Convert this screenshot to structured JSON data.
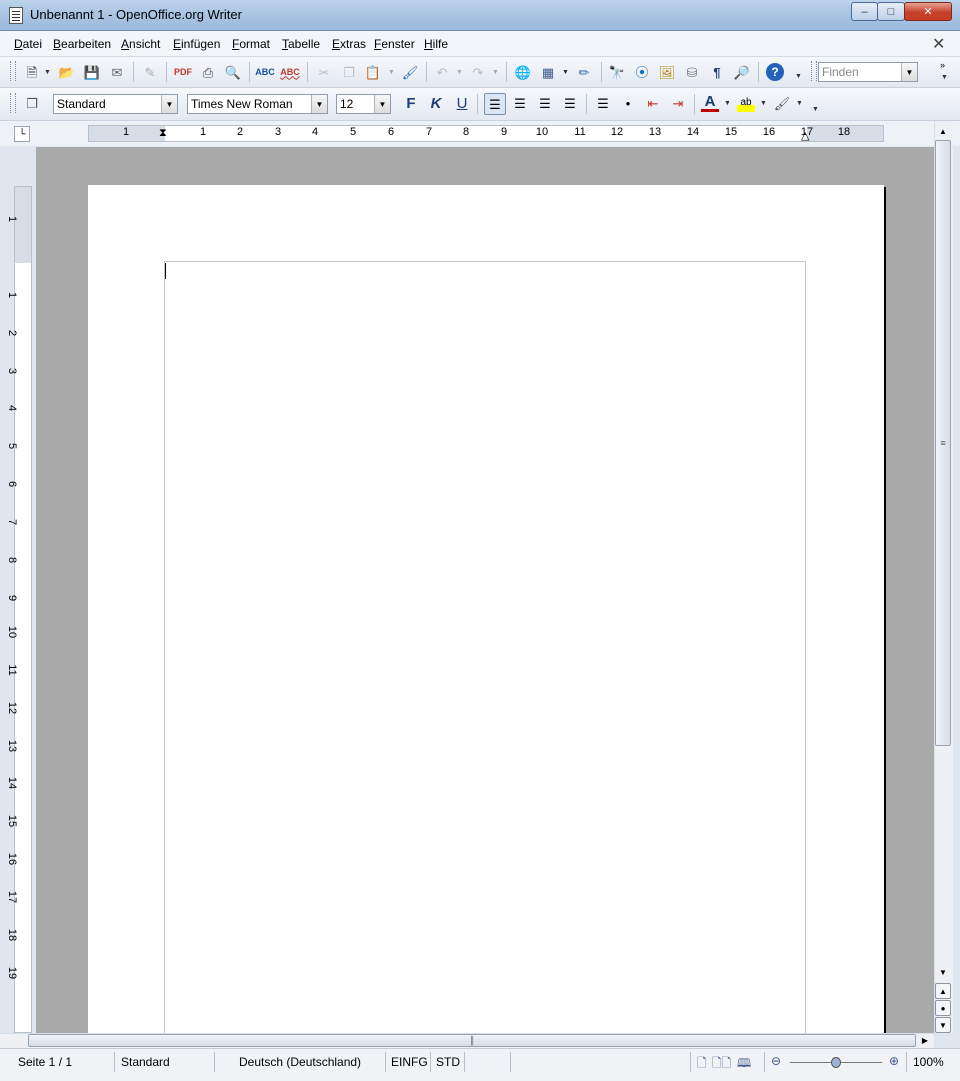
{
  "window": {
    "title": "Unbenannt 1 - OpenOffice.org Writer"
  },
  "menu": [
    "Datei",
    "Bearbeiten",
    "Ansicht",
    "Einfügen",
    "Format",
    "Tabelle",
    "Extras",
    "Fenster",
    "Hilfe"
  ],
  "toolbar": {
    "find_placeholder": "Finden",
    "style": "Standard",
    "font": "Times New Roman",
    "size": "12",
    "bold": "F",
    "italic": "K",
    "underline": "U"
  },
  "ruler": {
    "horizontal": [
      "1",
      "1",
      "2",
      "3",
      "4",
      "5",
      "6",
      "7",
      "8",
      "9",
      "10",
      "11",
      "12",
      "13",
      "14",
      "15",
      "16",
      "17",
      "18"
    ],
    "vertical": [
      "1",
      "1",
      "2",
      "3",
      "4",
      "5",
      "6",
      "7",
      "8",
      "9",
      "10",
      "11",
      "12",
      "13",
      "14",
      "15",
      "16",
      "17",
      "18",
      "19"
    ]
  },
  "status": {
    "page": "Seite 1 / 1",
    "style": "Standard",
    "language": "Deutsch (Deutschland)",
    "insert_mode": "EINFG",
    "selection_mode": "STD",
    "zoom": "100%",
    "zoom_level_percent": 100
  },
  "icons": {
    "new": "new-document-icon",
    "open": "open-folder-icon",
    "save": "save-icon",
    "email": "email-icon",
    "edit": "edit-file-icon",
    "pdf": "export-pdf-icon",
    "print": "print-icon",
    "preview": "print-preview-icon",
    "spell": "spellcheck-icon",
    "autospell": "auto-spellcheck-icon",
    "cut": "cut-icon",
    "copy": "copy-icon",
    "paste": "paste-icon",
    "clone": "clone-format-icon",
    "undo": "undo-icon",
    "redo": "redo-icon",
    "hyperlink": "hyperlink-icon",
    "table": "table-icon",
    "draw": "draw-functions-icon",
    "find": "find-replace-icon",
    "navigator": "navigator-icon",
    "gallery": "gallery-icon",
    "datasource": "data-sources-icon",
    "nonprint": "formatting-marks-icon",
    "zoom": "zoom-icon",
    "help": "help-icon"
  }
}
